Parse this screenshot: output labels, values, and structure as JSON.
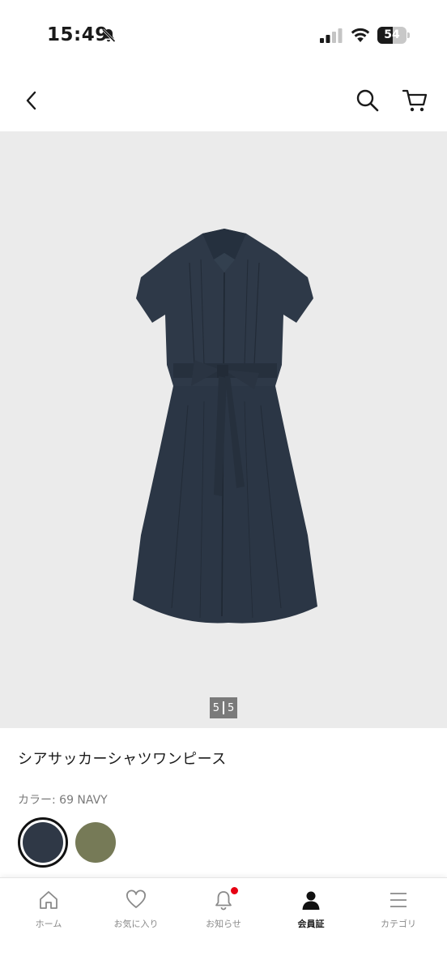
{
  "status_bar": {
    "time": "15:49",
    "battery": "54",
    "battery_level": 0.54
  },
  "header": {
    "back_icon": "chevron-left-icon",
    "search_icon": "search-icon",
    "cart_icon": "cart-icon"
  },
  "gallery": {
    "page_current": "5",
    "page_total": "5",
    "background_color": "#ebebeb",
    "product_color": "#2b3645"
  },
  "product": {
    "name": "シアサッカーシャツワンピース",
    "color_label": "カラー: 69 NAVY",
    "swatches": [
      {
        "color": "#2f3846",
        "selected": true
      },
      {
        "color": "#767a57",
        "selected": false
      }
    ]
  },
  "bottom_nav": {
    "items": [
      {
        "label": "ホーム",
        "icon": "home-icon",
        "active": false
      },
      {
        "label": "お気に入り",
        "icon": "heart-icon",
        "active": false
      },
      {
        "label": "お知らせ",
        "icon": "bell-icon",
        "active": false,
        "badge": true
      },
      {
        "label": "会員証",
        "icon": "person-icon",
        "active": true
      },
      {
        "label": "カテゴリ",
        "icon": "menu-icon",
        "active": false
      }
    ]
  }
}
